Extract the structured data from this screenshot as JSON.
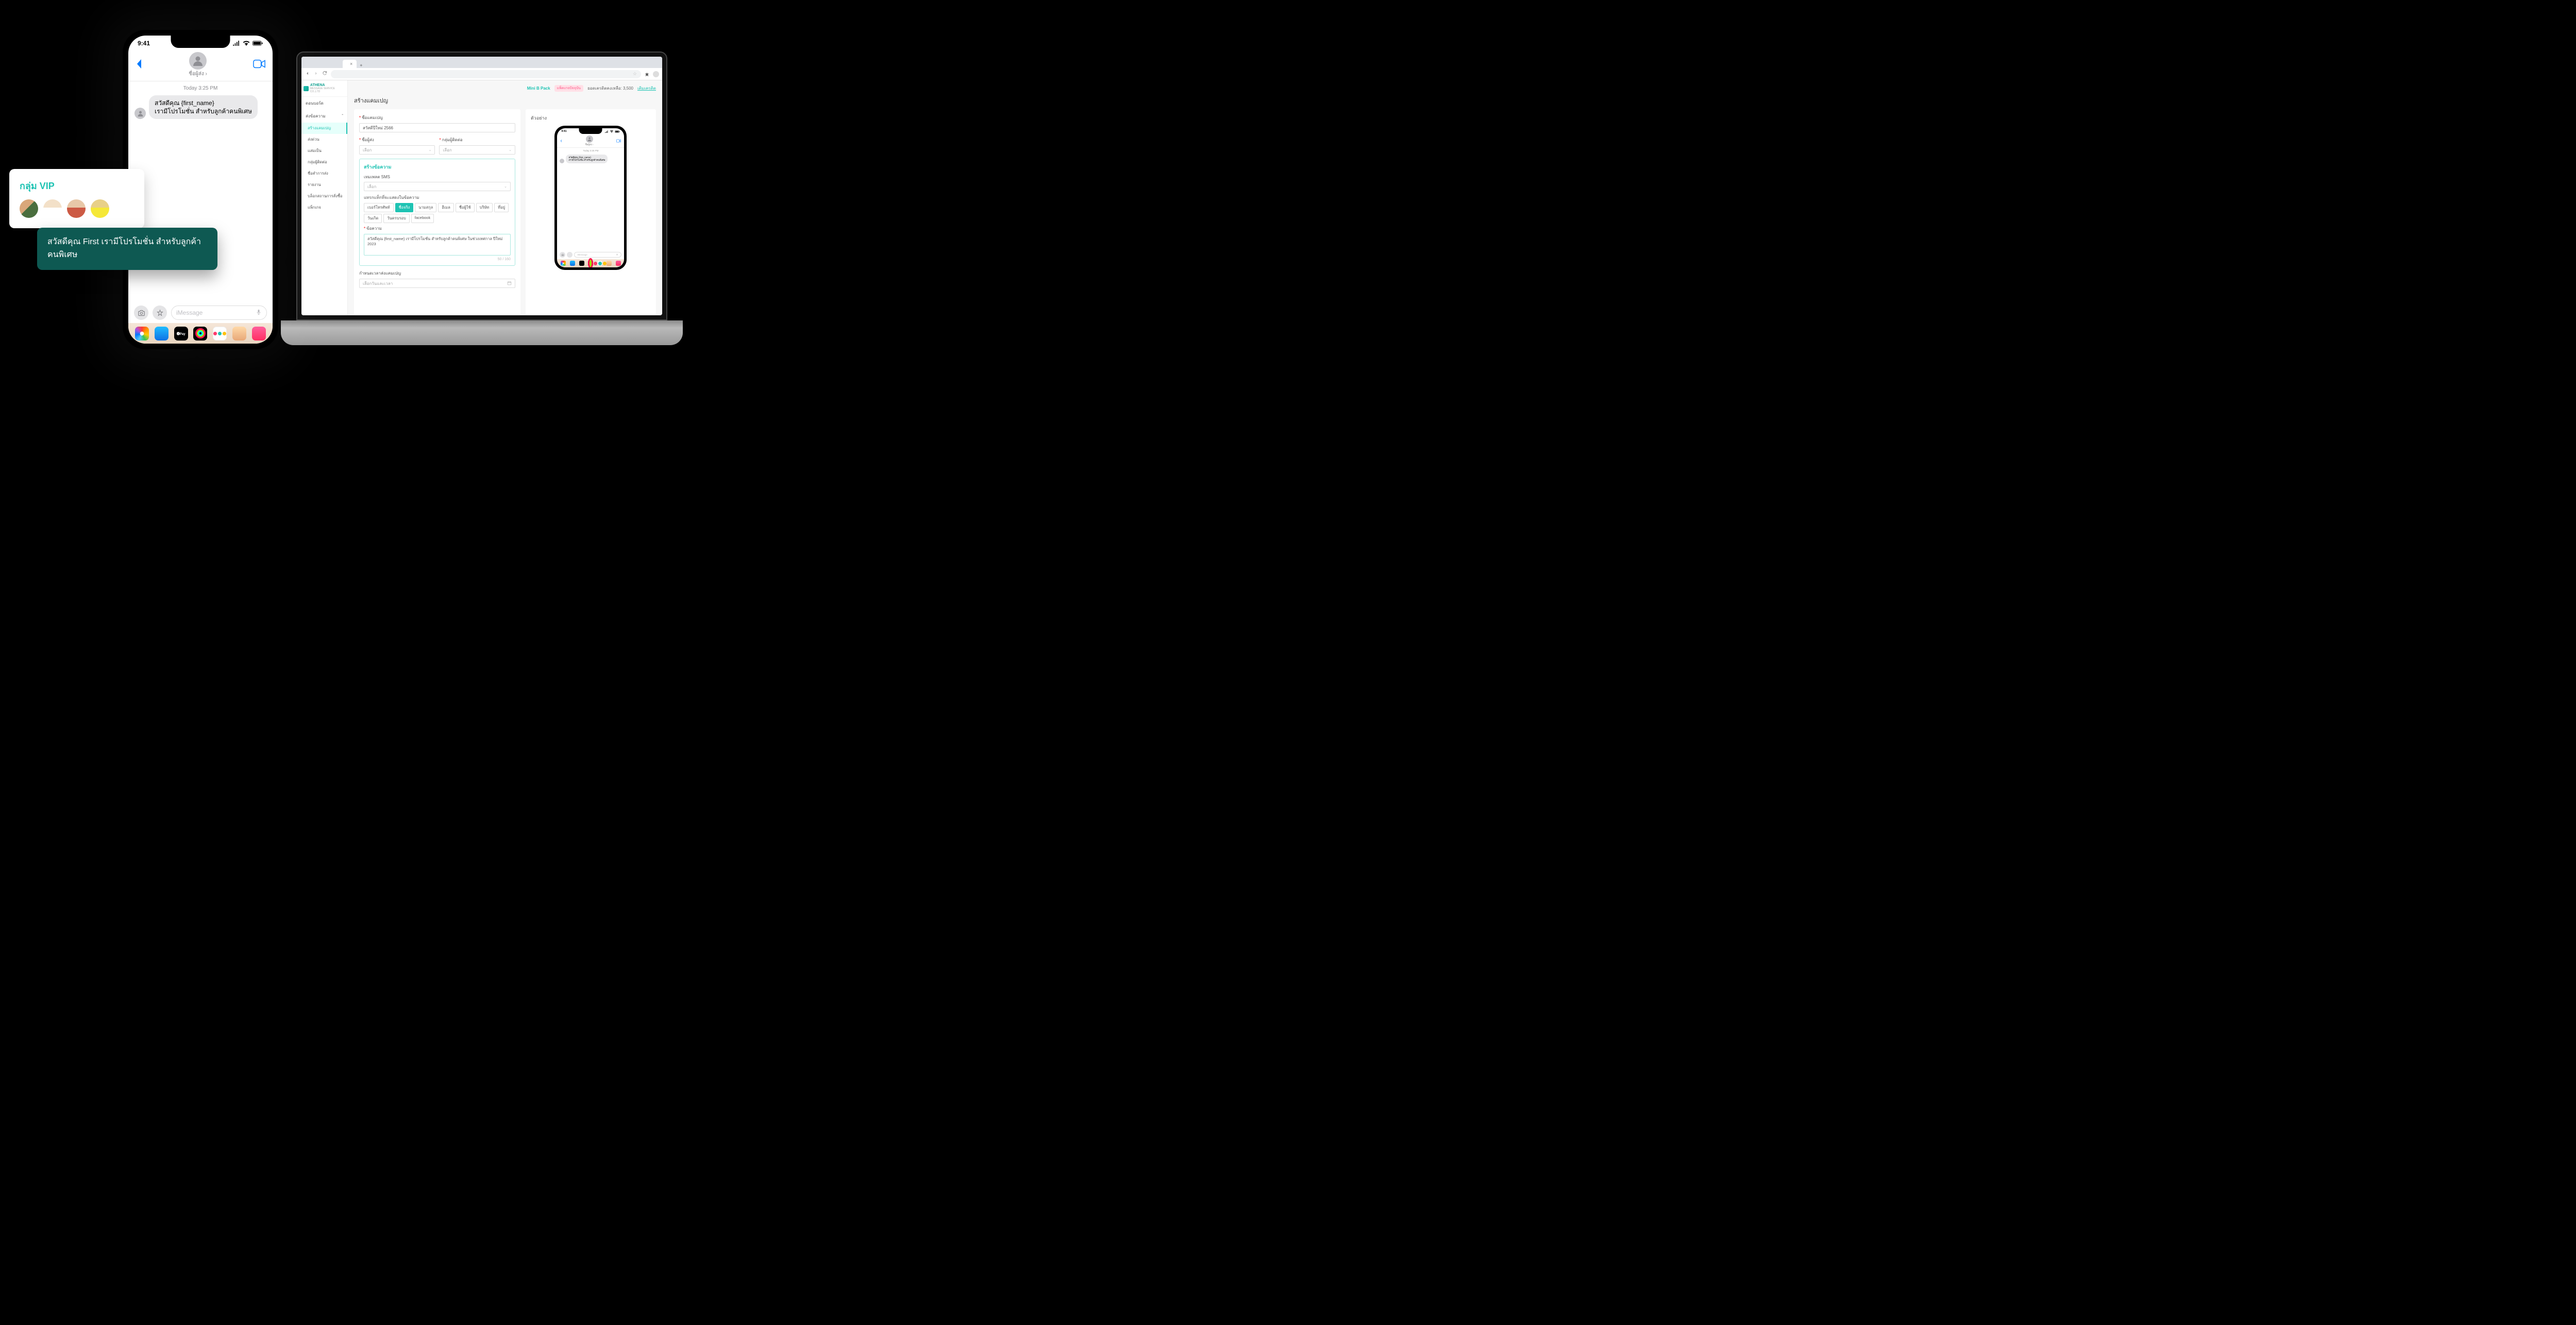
{
  "phone": {
    "time": "9:41",
    "sender_label": "ชื่อผู้ส่ง ›",
    "timestamp": "Today 3:25 PM",
    "message": {
      "line1": "สวัสดีคุณ {first_name}",
      "line2": "เรามีโปรโมชั่น สำหรับลูกค้าคนพิเศษ"
    },
    "input_placeholder": "iMessage",
    "apple_pay": "🅐Pay"
  },
  "vip": {
    "title": "กลุ่ม VIP"
  },
  "toast": {
    "text": "สวัสดีคุณ First เรามีโปรโมชั่น สำหรับลูกค้าคนพิเศษ"
  },
  "laptop": {
    "browser": {
      "tab_close": "×",
      "new_tab": "+",
      "star": "☆"
    },
    "logo": {
      "name": "ATHENA",
      "sub": "MESSAGE SERVICE CO.,LTD"
    },
    "sidebar": {
      "items": [
        "ดอนบอร์ด",
        "ส่งข้อความ"
      ],
      "sub": [
        "สร้างแคมเปญ",
        "ส่งด่วน",
        "แสมเป็น",
        "กลุ่มผู้ติดต่อ",
        "ชื่อคำการส่ง",
        "รายงาน",
        "บล็อกสถานการสั่งซื้อ",
        "แพ็กเกจ"
      ],
      "caret": "ˆ"
    },
    "topbar": {
      "pack": "Mini B Pack",
      "badge": "แพ็คเกจปัจจุบัน",
      "credit_label": "ยอดเครดิตคงเหลือ:",
      "credit_value": "3,500",
      "topup": "เติมเครดิต"
    },
    "page_title": "สร้างแคมเปญ",
    "form": {
      "campaign_name_label": "ชื่อแคมเปญ",
      "campaign_name_value": "สวัสดีปีใหม่ 2566",
      "sender_label": "ชื่อผู้ส่ง",
      "contact_label": "กลุ่มผู้ติดต่อ",
      "select_placeholder": "เลือก",
      "msg_block_title": "สร้างข้อความ",
      "template_label": "เทมเพลต SMS",
      "tag_label": "แทรกแท็กที่จะแสดงในข้อความ",
      "tags": [
        "เบอร์โทรศัพท์",
        "ชื่อจริง",
        "นามสกุล",
        "อีเมล",
        "ชื่อผู้ใช้",
        "บริษัท",
        "ที่อยู่",
        "วันเกิด",
        "วันครบรอบ",
        "facebook"
      ],
      "active_tag_index": 1,
      "message_label": "ข้อความ",
      "message_value": "สวัสดีคุณ {first_name} เรามีโปรโมชั่น สำหรับลูกค้าคนพิเศษ ในช่วงเทศกาล ปีใหม่ 2023",
      "char_count": "50 / 160",
      "schedule_label": "กำหนดเวลาส่งแคมเปญ",
      "schedule_placeholder": "เลือกวันและเวลา"
    },
    "preview": {
      "title": "ตัวอย่าง",
      "phone": {
        "time": "9:41",
        "sender": "ชื่อผู้ส่ง ›",
        "timestamp": "Today 3:25 PM",
        "msg_l1": "สวัสดีคุณ {first_name}",
        "msg_l2": "เรามีโปรโมชั่น สำหรับลูกค้าคนพิเศษ",
        "placeholder": "iMessage"
      }
    }
  }
}
